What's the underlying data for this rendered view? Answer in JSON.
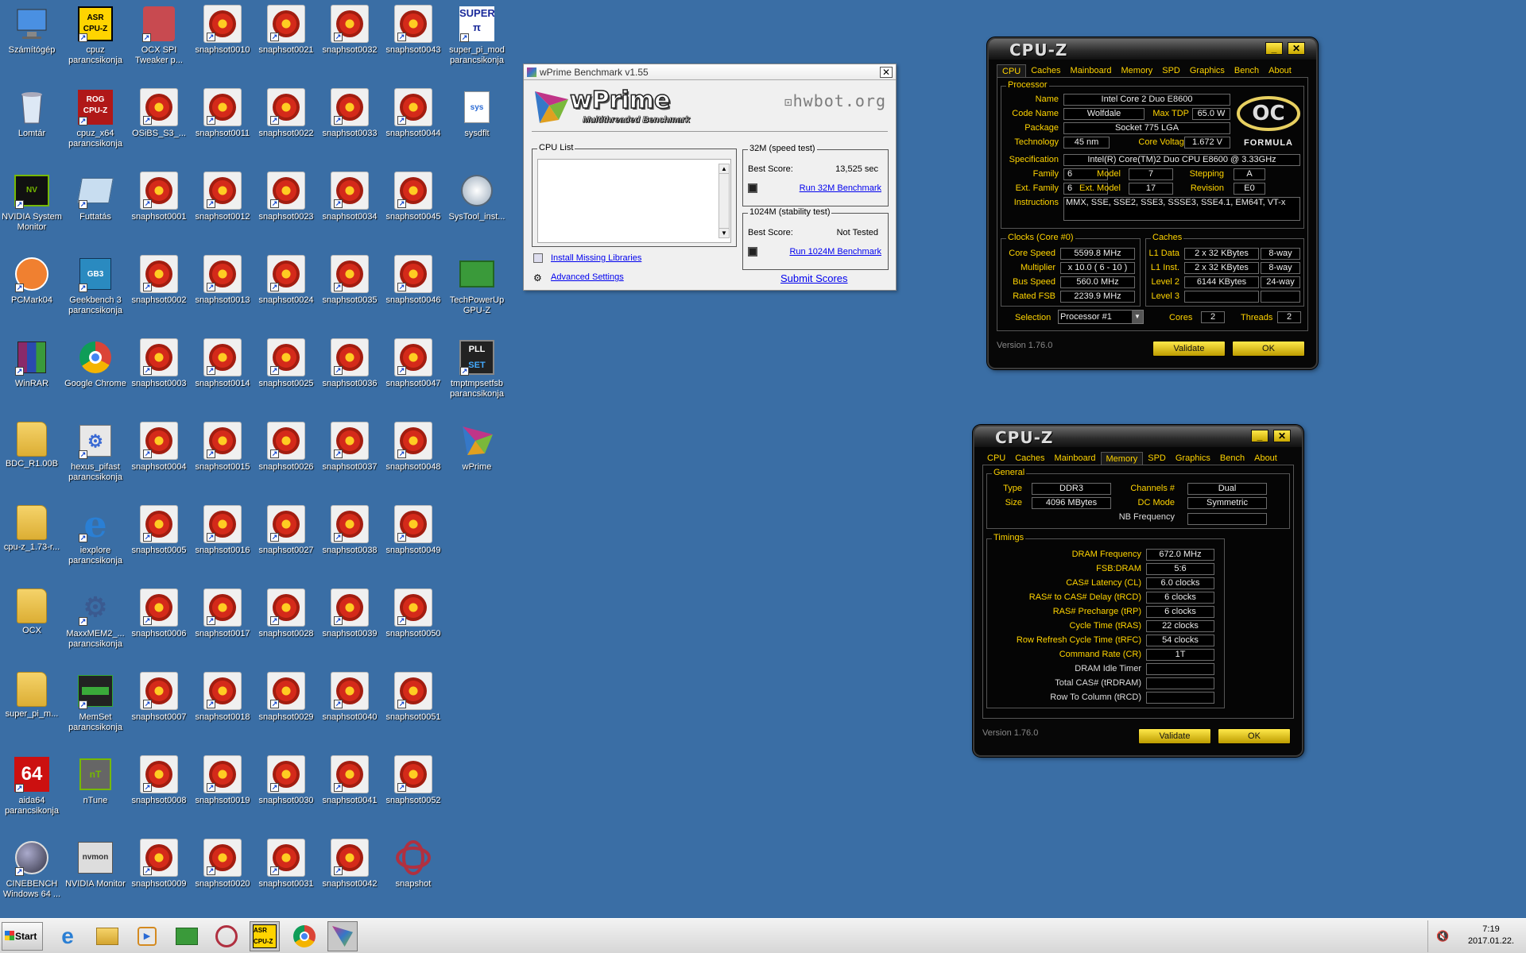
{
  "desktop": {
    "icons": [
      {
        "label": "Számítógép",
        "type": "computer"
      },
      {
        "label": "Lomtár",
        "type": "recycle"
      },
      {
        "label": "NVIDIA System Monitor",
        "type": "nvidia"
      },
      {
        "label": "PCMark04",
        "type": "pcmark"
      },
      {
        "label": "WinRAR",
        "type": "winrar"
      },
      {
        "label": "BDC_R1.00B",
        "type": "folder"
      },
      {
        "label": "cpu-z_1.73-r...",
        "type": "folder"
      },
      {
        "label": "OCX",
        "type": "folder"
      },
      {
        "label": "super_pi_m...",
        "type": "folder"
      },
      {
        "label": "aida64 parancsikonja",
        "type": "aida"
      },
      {
        "label": "CINEBENCH Windows 64 ...",
        "type": "cinebench"
      },
      {
        "label": "cpuz parancsikonja",
        "type": "cpuz"
      },
      {
        "label": "cpuz_x64 parancsikonja",
        "type": "rog"
      },
      {
        "label": "Futtatás",
        "type": "run"
      },
      {
        "label": "Geekbench 3 parancsikonja",
        "type": "geek"
      },
      {
        "label": "Google Chrome",
        "type": "chrome"
      },
      {
        "label": "hexus_pifast parancsikonja",
        "type": "hexus"
      },
      {
        "label": "iexplore parancsikonja",
        "type": "ie"
      },
      {
        "label": "MaxxMEM2_... parancsikonja",
        "type": "gears"
      },
      {
        "label": "MemSet parancsikonja",
        "type": "memset"
      },
      {
        "label": "nTune",
        "type": "ntune"
      },
      {
        "label": "NVIDIA Monitor",
        "type": "nvmon"
      },
      {
        "label": "OCX SPI Tweaker p...",
        "type": "ocx"
      },
      {
        "label": "OSiBS_S3_...",
        "type": "snap"
      },
      {
        "label": "snaphsot0001",
        "type": "snap"
      },
      {
        "label": "snaphsot0002",
        "type": "snap"
      },
      {
        "label": "snaphsot0003",
        "type": "snap"
      },
      {
        "label": "snaphsot0004",
        "type": "snap"
      },
      {
        "label": "snaphsot0005",
        "type": "snap"
      },
      {
        "label": "snaphsot0006",
        "type": "snap"
      },
      {
        "label": "snaphsot0007",
        "type": "snap"
      },
      {
        "label": "snaphsot0008",
        "type": "snap"
      },
      {
        "label": "snaphsot0009",
        "type": "snap"
      },
      {
        "label": "snaphsot0010",
        "type": "snap"
      },
      {
        "label": "snaphsot0011",
        "type": "snap"
      },
      {
        "label": "snaphsot0012",
        "type": "snap"
      },
      {
        "label": "snaphsot0013",
        "type": "snap"
      },
      {
        "label": "snaphsot0014",
        "type": "snap"
      },
      {
        "label": "snaphsot0015",
        "type": "snap"
      },
      {
        "label": "snaphsot0016",
        "type": "snap"
      },
      {
        "label": "snaphsot0017",
        "type": "snap"
      },
      {
        "label": "snaphsot0018",
        "type": "snap"
      },
      {
        "label": "snaphsot0019",
        "type": "snap"
      },
      {
        "label": "snaphsot0020",
        "type": "snap"
      },
      {
        "label": "snaphsot0021",
        "type": "snap"
      },
      {
        "label": "snaphsot0022",
        "type": "snap"
      },
      {
        "label": "snaphsot0023",
        "type": "snap"
      },
      {
        "label": "snaphsot0024",
        "type": "snap"
      },
      {
        "label": "snaphsot0025",
        "type": "snap"
      },
      {
        "label": "snaphsot0026",
        "type": "snap"
      },
      {
        "label": "snaphsot0027",
        "type": "snap"
      },
      {
        "label": "snaphsot0028",
        "type": "snap"
      },
      {
        "label": "snaphsot0029",
        "type": "snap"
      },
      {
        "label": "snaphsot0030",
        "type": "snap"
      },
      {
        "label": "snaphsot0031",
        "type": "snap"
      },
      {
        "label": "snaphsot0032",
        "type": "snap"
      },
      {
        "label": "snaphsot0033",
        "type": "snap"
      },
      {
        "label": "snaphsot0034",
        "type": "snap"
      },
      {
        "label": "snaphsot0035",
        "type": "snap"
      },
      {
        "label": "snaphsot0036",
        "type": "snap"
      },
      {
        "label": "snaphsot0037",
        "type": "snap"
      },
      {
        "label": "snaphsot0038",
        "type": "snap"
      },
      {
        "label": "snaphsot0039",
        "type": "snap"
      },
      {
        "label": "snaphsot0040",
        "type": "snap"
      },
      {
        "label": "snaphsot0041",
        "type": "snap"
      },
      {
        "label": "snaphsot0042",
        "type": "snap"
      },
      {
        "label": "snaphsot0043",
        "type": "snap"
      },
      {
        "label": "snaphsot0044",
        "type": "snap"
      },
      {
        "label": "snaphsot0045",
        "type": "snap"
      },
      {
        "label": "snaphsot0046",
        "type": "snap"
      },
      {
        "label": "snaphsot0047",
        "type": "snap"
      },
      {
        "label": "snaphsot0048",
        "type": "snap"
      },
      {
        "label": "snaphsot0049",
        "type": "snap"
      },
      {
        "label": "snaphsot0050",
        "type": "snap"
      },
      {
        "label": "snaphsot0051",
        "type": "snap"
      },
      {
        "label": "snaphsot0052",
        "type": "snap"
      },
      {
        "label": "snapshot",
        "type": "snapshot"
      },
      {
        "label": "super_pi_mod parancsikonja",
        "type": "superpi"
      },
      {
        "label": "sysdflt",
        "type": "sysdflt"
      },
      {
        "label": "SysTool_inst...",
        "type": "systool"
      },
      {
        "label": "TechPowerUp GPU-Z",
        "type": "gpuz"
      },
      {
        "label": "tmptmpsetfsb parancsikonja",
        "type": "pll"
      },
      {
        "label": "wPrime",
        "type": "wprime"
      }
    ]
  },
  "wprime": {
    "title": "wPrime Benchmark v1.55",
    "logo_text": "wPrime",
    "logo_sub": "Multithreaded Benchmark",
    "hwbot": "hwbot.org",
    "cpu_list_label": "CPU List",
    "install_link": "Install Missing Libraries",
    "advanced_link": "Advanced Settings",
    "g32_label": "32M (speed test)",
    "g32_score_label": "Best Score:",
    "g32_score": "13,525 sec",
    "g32_run": "Run 32M Benchmark",
    "g1024_label": "1024M (stability test)",
    "g1024_score_label": "Best Score:",
    "g1024_score": "Not Tested",
    "g1024_run": "Run 1024M Benchmark",
    "submit": "Submit Scores",
    "close": "✕"
  },
  "cpuz1": {
    "title": "CPU-Z",
    "tabs": [
      "CPU",
      "Caches",
      "Mainboard",
      "Memory",
      "SPD",
      "Graphics",
      "Bench",
      "About"
    ],
    "processor_label": "Processor",
    "name_l": "Name",
    "name": "Intel Core 2 Duo E8600",
    "code_l": "Code Name",
    "code": "Wolfdale",
    "tdp_l": "Max TDP",
    "tdp": "65.0 W",
    "pkg_l": "Package",
    "pkg": "Socket 775 LGA",
    "tech_l": "Technology",
    "tech": "45 nm",
    "volt_l": "Core Voltage",
    "volt": "1.672 V",
    "spec_l": "Specification",
    "spec": "Intel(R) Core(TM)2 Duo CPU     E8600  @ 3.33GHz",
    "fam_l": "Family",
    "fam": "6",
    "model_l": "Model",
    "model": "7",
    "step_l": "Stepping",
    "step": "A",
    "efam_l": "Ext. Family",
    "efam": "6",
    "emodel_l": "Ext. Model",
    "emodel": "17",
    "rev_l": "Revision",
    "rev": "E0",
    "instr_l": "Instructions",
    "instr": "MMX, SSE, SSE2, SSE3, SSSE3, SSE4.1, EM64T, VT-x",
    "clocks_label": "Clocks (Core #0)",
    "cs_l": "Core Speed",
    "cs": "5599.8 MHz",
    "mult_l": "Multiplier",
    "mult": "x 10.0 ( 6 - 10 )",
    "bus_l": "Bus Speed",
    "bus": "560.0 MHz",
    "fsb_l": "Rated FSB",
    "fsb": "2239.9 MHz",
    "caches_label": "Caches",
    "l1d_l": "L1 Data",
    "l1d": "2 x 32 KBytes",
    "l1d_w": "8-way",
    "l1i_l": "L1 Inst.",
    "l1i": "2 x 32 KBytes",
    "l1i_w": "8-way",
    "l2_l": "Level 2",
    "l2": "6144 KBytes",
    "l2_w": "24-way",
    "l3_l": "Level 3",
    "sel_l": "Selection",
    "sel": "Processor #1",
    "cores_l": "Cores",
    "cores": "2",
    "threads_l": "Threads",
    "threads": "2",
    "version": "Version 1.76.0",
    "validate": "Validate",
    "ok": "OK",
    "logo": "FORMULA"
  },
  "cpuz2": {
    "title": "CPU-Z",
    "tabs": [
      "CPU",
      "Caches",
      "Mainboard",
      "Memory",
      "SPD",
      "Graphics",
      "Bench",
      "About"
    ],
    "general_label": "General",
    "type_l": "Type",
    "type": "DDR3",
    "size_l": "Size",
    "size": "4096 MBytes",
    "ch_l": "Channels #",
    "ch": "Dual",
    "dc_l": "DC Mode",
    "dc": "Symmetric",
    "nb_l": "NB Frequency",
    "timings_label": "Timings",
    "timings": [
      {
        "label": "DRAM Frequency",
        "value": "672.0 MHz"
      },
      {
        "label": "FSB:DRAM",
        "value": "5:6"
      },
      {
        "label": "CAS# Latency (CL)",
        "value": "6.0 clocks"
      },
      {
        "label": "RAS# to CAS# Delay (tRCD)",
        "value": "6 clocks"
      },
      {
        "label": "RAS# Precharge (tRP)",
        "value": "6 clocks"
      },
      {
        "label": "Cycle Time (tRAS)",
        "value": "22 clocks"
      },
      {
        "label": "Row Refresh Cycle Time (tRFC)",
        "value": "54 clocks"
      },
      {
        "label": "Command Rate (CR)",
        "value": "1T"
      },
      {
        "label": "DRAM Idle Timer",
        "value": ""
      },
      {
        "label": "Total CAS# (tRDRAM)",
        "value": ""
      },
      {
        "label": "Row To Column (tRCD)",
        "value": ""
      }
    ],
    "version": "Version 1.76.0",
    "validate": "Validate",
    "ok": "OK"
  },
  "taskbar": {
    "start": "Start",
    "time": "7:19",
    "date": "2017.01.22."
  }
}
